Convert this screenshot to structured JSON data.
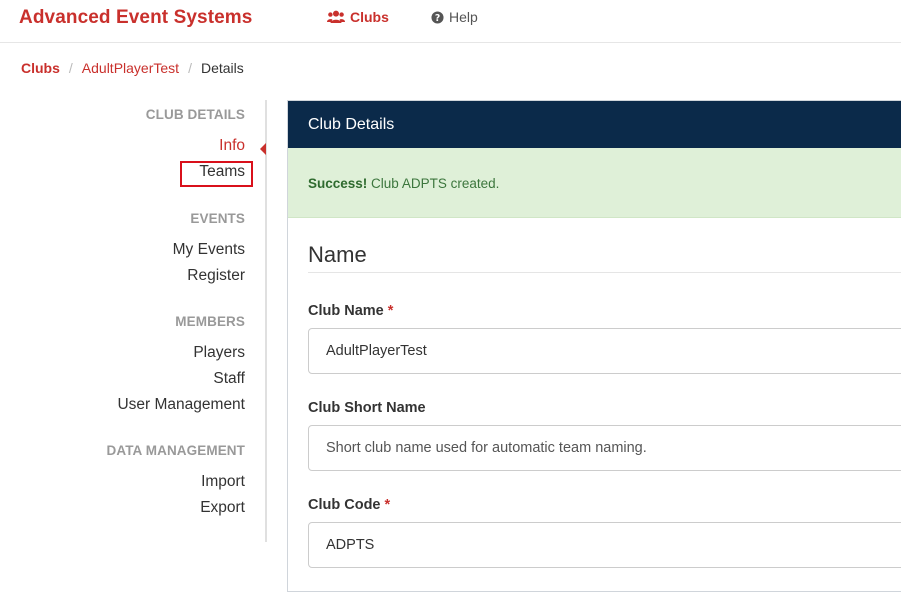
{
  "header": {
    "brand": "Advanced Event Systems",
    "nav": [
      {
        "label": "Clubs",
        "icon": "users-icon"
      },
      {
        "label": "Help",
        "icon": "question-circle-icon"
      }
    ]
  },
  "breadcrumb": [
    "Clubs",
    "AdultPlayerTest",
    "Details"
  ],
  "sidebar": {
    "club_details": {
      "heading": "CLUB DETAILS",
      "items": [
        "Info",
        "Teams"
      ]
    },
    "events": {
      "heading": "EVENTS",
      "items": [
        "My Events",
        "Register"
      ]
    },
    "members": {
      "heading": "MEMBERS",
      "items": [
        "Players",
        "Staff",
        "User Management"
      ]
    },
    "data_management": {
      "heading": "DATA MANAGEMENT",
      "items": [
        "Import",
        "Export"
      ]
    }
  },
  "panel": {
    "title": "Club Details",
    "alert": {
      "strong": "Success!",
      "message": " Club ADPTS created."
    },
    "section_title": "Name",
    "fields": {
      "club_name": {
        "label": "Club Name",
        "required": "*",
        "value": "AdultPlayerTest"
      },
      "club_short_name": {
        "label": "Club Short Name",
        "placeholder": "Short club name used for automatic team naming."
      },
      "club_code": {
        "label": "Club Code",
        "required": "*",
        "value": "ADPTS"
      }
    }
  },
  "colors": {
    "brand": "#c9302c",
    "panel_header": "#0b2a4a",
    "alert_bg": "#dff0d8",
    "alert_text": "#3c763d",
    "highlight_box": "#d9101b"
  }
}
